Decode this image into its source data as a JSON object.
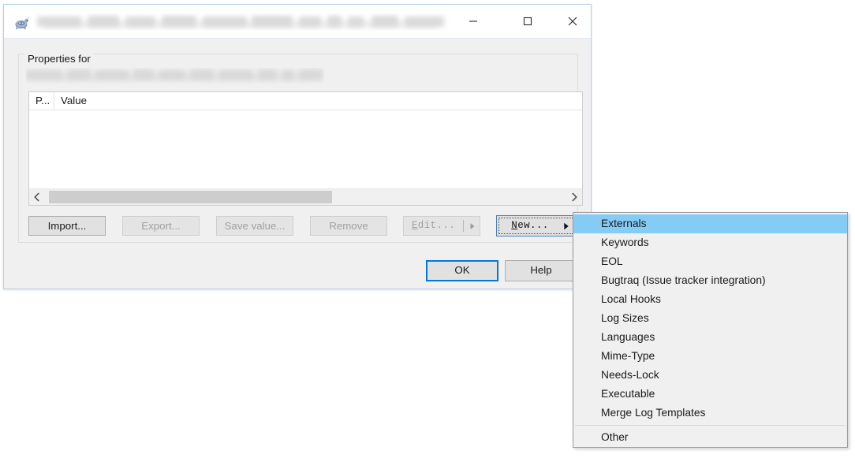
{
  "window": {
    "title": "",
    "title_redacted": true,
    "app_icon": "tortoise-icon",
    "controls": {
      "minimize": "minimize-icon",
      "maximize": "maximize-icon",
      "close": "close-icon"
    }
  },
  "group": {
    "legend": "Properties for",
    "path": "",
    "path_redacted": true
  },
  "list": {
    "columns": [
      "P...",
      "Value"
    ],
    "rows": [],
    "hscroll": {
      "left_arrow": "‹",
      "right_arrow": "›"
    }
  },
  "buttons": {
    "import": {
      "label": "Import...",
      "enabled": true
    },
    "export": {
      "label": "Export...",
      "enabled": false
    },
    "save_value": {
      "label": "Save value...",
      "enabled": false
    },
    "remove": {
      "label": "Remove",
      "enabled": false
    },
    "edit": {
      "label_pre": "",
      "label_mnemonic": "E",
      "label_post": "dit...",
      "enabled": false,
      "has_dropdown": true
    },
    "new": {
      "label_pre": "",
      "label_mnemonic": "N",
      "label_post": "ew...",
      "enabled": true,
      "has_dropdown": true,
      "focused": true
    },
    "ok": {
      "label": "OK",
      "default": true
    },
    "help": {
      "label": "Help",
      "default": false
    }
  },
  "new_menu": {
    "items": [
      {
        "label": "Externals",
        "selected": true
      },
      {
        "label": "Keywords",
        "selected": false
      },
      {
        "label": "EOL",
        "selected": false
      },
      {
        "label": "Bugtraq (Issue tracker integration)",
        "selected": false
      },
      {
        "label": "Local Hooks",
        "selected": false
      },
      {
        "label": "Log Sizes",
        "selected": false
      },
      {
        "label": "Languages",
        "selected": false
      },
      {
        "label": "Mime-Type",
        "selected": false
      },
      {
        "label": "Needs-Lock",
        "selected": false
      },
      {
        "label": "Executable",
        "selected": false
      },
      {
        "label": "Merge Log Templates",
        "selected": false
      },
      {
        "separator": true
      },
      {
        "label": "Other",
        "selected": false
      }
    ]
  },
  "colors": {
    "window_border": "#b5d0e8",
    "dialog_face": "#f0f0f0",
    "accent_default_button": "#0078d7",
    "menu_highlight": "#85ccf5",
    "menu_face": "#f0f0f0",
    "disabled_text": "#a0a0a0"
  }
}
